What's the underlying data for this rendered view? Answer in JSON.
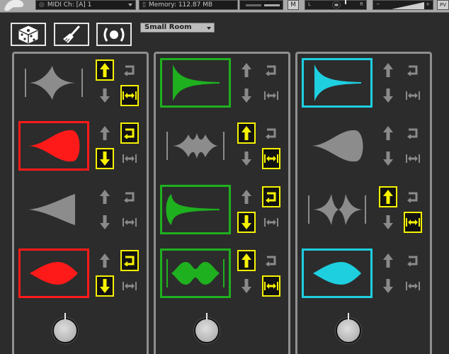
{
  "host": {
    "midi_label": "MIDI Ch:",
    "midi_value": "[A]  1",
    "memory_label": "Memory:",
    "memory_value": "112.87 MB",
    "m_label": "M",
    "pan_left": "L",
    "pan_right": "R",
    "tune_minus": "−",
    "tune_plus": "+",
    "pv_label": "PV"
  },
  "toolbar": {
    "randomize_icon": "dice-icon",
    "clear_icon": "broom-icon",
    "reverb_icon": "reverb-icon",
    "reverb_select": "Small Room"
  },
  "colors": {
    "red": "#ff1a1a",
    "green": "#1fb01f",
    "cyan": "#1ecfe0",
    "inactive": "#8c8c8c",
    "highlight": "#f6f200"
  },
  "columns": [
    {
      "color": "red",
      "slots": [
        {
          "shape": "star-shape",
          "active": false,
          "bracketed": true,
          "up": true,
          "loop": false,
          "down": false,
          "stretch": true
        },
        {
          "shape": "swell-shape",
          "active": true,
          "bracketed": false,
          "up": false,
          "loop": true,
          "down": true,
          "stretch": false
        },
        {
          "shape": "fade-in-shape",
          "active": false,
          "bracketed": false,
          "up": false,
          "loop": false,
          "down": false,
          "stretch": false
        },
        {
          "shape": "lens-shape",
          "active": true,
          "bracketed": false,
          "up": false,
          "loop": true,
          "down": true,
          "stretch": false
        }
      ]
    },
    {
      "color": "green",
      "slots": [
        {
          "shape": "decay-shape",
          "active": true,
          "bracketed": false,
          "up": false,
          "loop": false,
          "down": false,
          "stretch": false
        },
        {
          "shape": "burst-shape",
          "active": false,
          "bracketed": true,
          "up": true,
          "loop": false,
          "down": false,
          "stretch": true
        },
        {
          "shape": "horn-shape",
          "active": true,
          "bracketed": false,
          "up": false,
          "loop": true,
          "down": true,
          "stretch": false
        },
        {
          "shape": "double-shape",
          "active": true,
          "bracketed": true,
          "up": true,
          "loop": false,
          "down": false,
          "stretch": true
        }
      ]
    },
    {
      "color": "cyan",
      "slots": [
        {
          "shape": "decay-shape",
          "active": true,
          "bracketed": false,
          "up": false,
          "loop": false,
          "down": false,
          "stretch": false
        },
        {
          "shape": "swell-shape",
          "active": false,
          "bracketed": false,
          "up": false,
          "loop": false,
          "down": false,
          "stretch": false
        },
        {
          "shape": "star-burst-shape",
          "active": false,
          "bracketed": true,
          "up": true,
          "loop": false,
          "down": false,
          "stretch": true
        },
        {
          "shape": "lens-shape",
          "active": true,
          "bracketed": false,
          "up": false,
          "loop": false,
          "down": false,
          "stretch": false
        }
      ]
    }
  ]
}
